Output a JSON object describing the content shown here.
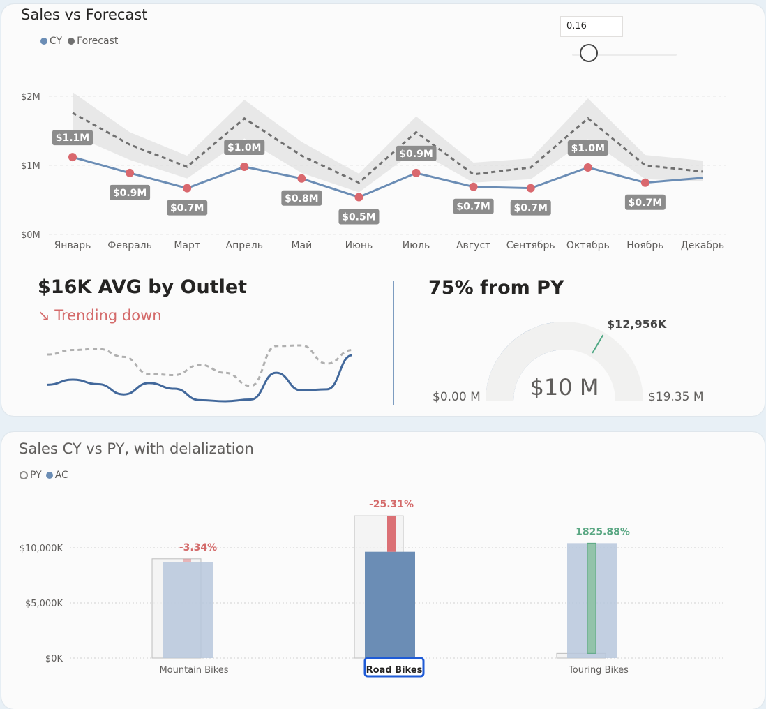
{
  "sales_forecast": {
    "title": "Sales vs Forecast",
    "legend": [
      {
        "label": "CY",
        "color": "#6b8db5"
      },
      {
        "label": "Forecast",
        "color": "#707070"
      }
    ],
    "slider": {
      "value": "0.16"
    },
    "chart_data": {
      "type": "line",
      "categories": [
        "Январь",
        "Февраль",
        "Март",
        "Апрель",
        "Май",
        "Июнь",
        "Июль",
        "Август",
        "Сентябрь",
        "Октябрь",
        "Ноябрь",
        "Декабрь"
      ],
      "y_ticks": [
        "$0M",
        "$1M",
        "$2M"
      ],
      "ylim": [
        0,
        2000000
      ],
      "series": [
        {
          "name": "CY",
          "values": [
            1120000,
            890000,
            670000,
            980000,
            810000,
            540000,
            890000,
            690000,
            670000,
            970000,
            750000,
            820000
          ],
          "labels": [
            "$1.1M",
            "$0.9M",
            "$0.7M",
            "$1.0M",
            "$0.8M",
            "$0.5M",
            "$0.9M",
            "$0.7M",
            "$0.7M",
            "$1.0M",
            "$0.7M",
            ""
          ]
        },
        {
          "name": "Forecast",
          "values": [
            1760000,
            1300000,
            980000,
            1680000,
            1140000,
            750000,
            1480000,
            870000,
            970000,
            1680000,
            1000000,
            910000
          ],
          "band_upper": [
            2060000,
            1480000,
            1140000,
            1950000,
            1340000,
            880000,
            1710000,
            1040000,
            1100000,
            1970000,
            1150000,
            1070000
          ],
          "band_lower": [
            1440000,
            1080000,
            810000,
            1390000,
            890000,
            610000,
            1220000,
            750000,
            800000,
            1380000,
            800000,
            770000
          ]
        }
      ]
    }
  },
  "kpi": {
    "title": "$16K AVG by Outlet",
    "trend": "↘ Trending down",
    "chart_data": {
      "type": "line",
      "series": [
        {
          "name": "current",
          "values": [
            5,
            14,
            6,
            -12,
            8,
            -2,
            -22,
            -24,
            -21,
            26,
            -5,
            -3,
            57
          ]
        },
        {
          "name": "previous",
          "values": [
            58,
            66,
            68,
            54,
            24,
            22,
            40,
            26,
            3,
            73,
            74,
            42,
            66
          ]
        }
      ]
    }
  },
  "gauge": {
    "title": "75% from PY",
    "value_label": "$10 M",
    "min_label": "$0.00 M",
    "max_label": "$19.35 M",
    "target_label": "$12,956K",
    "chart_data": {
      "type": "gauge",
      "value": 10,
      "min": 0,
      "max": 19.35,
      "target": 12.956
    }
  },
  "sales_cy_py": {
    "title": "Sales CY vs PY, with delalization",
    "legend": [
      {
        "label": "PY"
      },
      {
        "label": "AC",
        "color": "#6b8db5"
      }
    ],
    "chart_data": {
      "type": "bar",
      "categories": [
        "Mountain Bikes",
        "Road Bikes",
        "Touring Bikes"
      ],
      "selected": "Road Bikes",
      "y_ticks": [
        "$0K",
        "$5,000K",
        "$10,000K"
      ],
      "ylim": [
        0,
        13000
      ],
      "series": [
        {
          "name": "PY",
          "values": [
            9000,
            12900,
            420
          ]
        },
        {
          "name": "AC",
          "values": [
            8700,
            9640,
            10420
          ]
        }
      ],
      "variance_labels": [
        "-3.34%",
        "-25.31%",
        "1825.88%"
      ]
    }
  }
}
